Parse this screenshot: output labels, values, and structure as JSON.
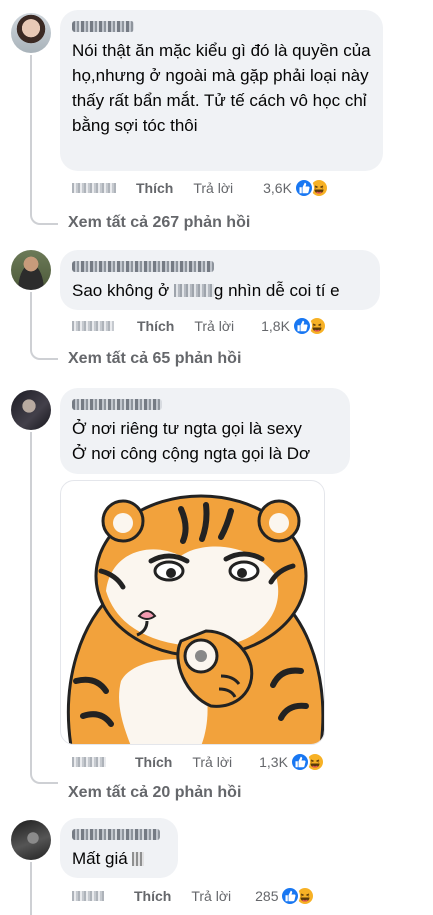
{
  "comments": [
    {
      "text": "Nói thật ăn mặc kiểu gì đó là quyền của họ,nhưng ở ngoài mà gặp phải loại này thấy rất bẩn mắt. Tử tế cách vô học chỉ bằng sợi tóc thôi",
      "like_label": "Thích",
      "reply_label": "Trả lời",
      "reaction_count": "3,6K",
      "view_replies": "Xem tất cả 267 phản hồi"
    },
    {
      "text_before": "Sao không ở",
      "text_after": "g nhìn dễ coi tí e",
      "like_label": "Thích",
      "reply_label": "Trả lời",
      "reaction_count": "1,8K",
      "view_replies": "Xem tất cả 65 phản hồi"
    },
    {
      "text_line1": "Ở nơi riêng tư ngta gọi là sexy",
      "text_line2": "Ở nơi công cộng ngta gọi là Dơ",
      "like_label": "Thích",
      "reply_label": "Trả lời",
      "reaction_count": "1,3K",
      "view_replies": "Xem tất cả 20 phản hồi"
    },
    {
      "text": "Mất giá",
      "like_label": "Thích",
      "reply_label": "Trả lời",
      "reaction_count": "285"
    }
  ],
  "icons": {
    "like": "thumbs-up-icon",
    "haha": "laughing-face-icon",
    "sticker": "tiger-sticker-pointing"
  },
  "colors": {
    "like_blue": "#1877f2",
    "haha_yellow": "#f7b125",
    "bubble": "#f0f2f5",
    "secondary_text": "#65676b"
  }
}
